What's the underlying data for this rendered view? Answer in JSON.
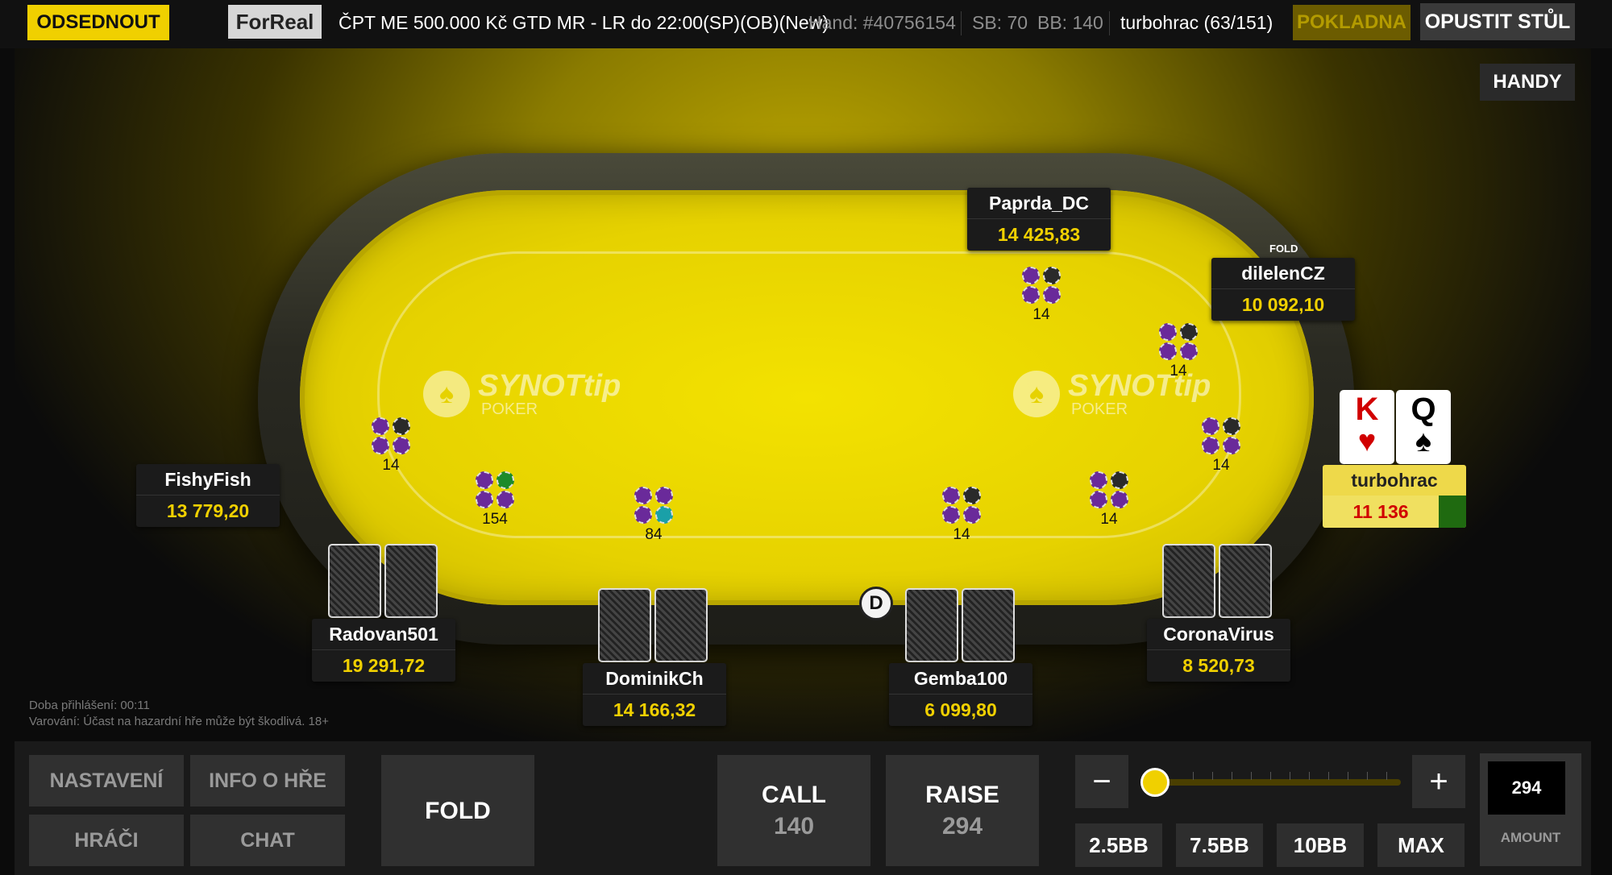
{
  "topbar": {
    "sitout_label": "ODSEDNOUT",
    "mode_label": "ForReal",
    "table_title": "ČPT ME 500.000 Kč GTD MR - LR do 22:00(SP)(OB)(New)",
    "hand_label": "Hand: #40756154",
    "sb_label": "SB: 70",
    "bb_label": "BB: 140",
    "user_label": "turbohrac (63/151)",
    "cashier_label": "POKLADNA",
    "leave_label": "OPUSTIT STŮL"
  },
  "hands_button": "HANDY",
  "logo": {
    "main": "SYNOTtip",
    "sub": "POKER"
  },
  "players": {
    "paprda": {
      "name": "Paprda_DC",
      "stack": "14 425,83"
    },
    "dilelen": {
      "name": "dilelenCZ",
      "stack": "10 092,10",
      "status": "FOLD"
    },
    "fishy": {
      "name": "FishyFish",
      "stack": "13 779,20"
    },
    "radovan": {
      "name": "Radovan501",
      "stack": "19 291,72"
    },
    "dominik": {
      "name": "DominikCh",
      "stack": "14 166,32"
    },
    "gemba": {
      "name": "Gemba100",
      "stack": "6 099,80"
    },
    "corona": {
      "name": "CoronaVirus",
      "stack": "8 520,73"
    },
    "hero": {
      "name": "turbohrac",
      "stack": "11 136"
    }
  },
  "hero_cards": [
    {
      "rank": "K",
      "suit": "♥",
      "color": "red"
    },
    {
      "rank": "Q",
      "suit": "♠",
      "color": "black"
    }
  ],
  "bets": {
    "paprda": "14",
    "dilelen": "14",
    "hero": "14",
    "fishy": "14",
    "radovan": "154",
    "dominik": "84",
    "gemba": "14",
    "corona": "14"
  },
  "dealer_label": "D",
  "login_info": {
    "time_label": "Doba přihlášení:  00:11",
    "warning": "Varování: Účast na hazardní hře může být škodlivá. 18+"
  },
  "bottom": {
    "settings": "NASTAVENÍ",
    "game_info": "INFO O HŘE",
    "players": "HRÁČI",
    "chat": "CHAT",
    "fold": "FOLD",
    "call_label": "CALL",
    "call_amount": "140",
    "raise_label": "RAISE",
    "raise_amount": "294",
    "minus": "−",
    "plus": "+",
    "presets": [
      "2.5BB",
      "7.5BB",
      "10BB",
      "MAX"
    ],
    "amount_value": "294",
    "amount_label": "AMOUNT"
  },
  "colors": {
    "accent": "#f0d000",
    "felt": "#e6d200",
    "stack": "#f0d000",
    "hero_stack": "#d10000"
  }
}
